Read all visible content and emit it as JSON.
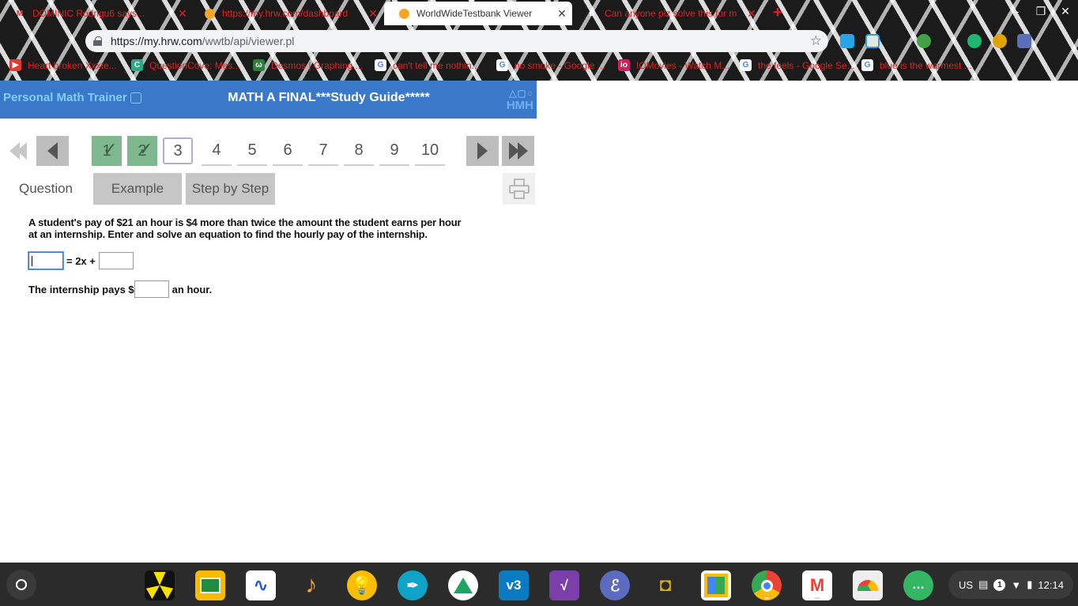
{
  "browser": {
    "tabs": [
      {
        "title": "DOMINIC Rodrigu6 says...",
        "icon": "gmail-icon",
        "active": false
      },
      {
        "title": "https://my.hrw.com/dashboard",
        "icon": "hrw-icon",
        "active": false
      },
      {
        "title": "WorldWideTestbank Viewer",
        "icon": "hrw-icon",
        "active": true
      },
      {
        "title": "Can anyone plz solve this for m",
        "icon": "brainly-icon",
        "active": false
      }
    ],
    "new_tab": "+",
    "url_host": "https://my.hrw.com",
    "url_path": "/wwtb/api/viewer.pl",
    "bookmarks": [
      {
        "label": "Heart broken Xxxte...",
        "icon": "youtube-icon",
        "color": "#e53935"
      },
      {
        "label": "QuestionCove: Mes...",
        "icon": "questioncove-icon",
        "color": "#2fa88a"
      },
      {
        "label": "Desmos | Graphing ...",
        "icon": "desmos-icon",
        "color": "#2a7f3a"
      },
      {
        "label": "can't tell me nothin...",
        "icon": "google-icon",
        "color": "#4285f4"
      },
      {
        "label": "no smoke - Google ...",
        "icon": "google-icon",
        "color": "#4285f4"
      },
      {
        "label": "IOMovies - Watch M...",
        "icon": "iomovies-icon",
        "color": "#d81b60"
      },
      {
        "label": "the feels - Google Se...",
        "icon": "google-icon",
        "color": "#4285f4"
      },
      {
        "label": "blue is the warmest ...",
        "icon": "google-icon",
        "color": "#4285f4"
      }
    ]
  },
  "app": {
    "brand": "Personal Math Trainer",
    "title": "MATH A FINAL***Study Guide*****",
    "logo_text": "HMH",
    "questions": [
      "1",
      "2",
      "3",
      "4",
      "5",
      "6",
      "7",
      "8",
      "9",
      "10"
    ],
    "current_question": "3",
    "tabs": {
      "question": "Question",
      "example": "Example",
      "step": "Step by Step"
    },
    "prompt": "A student's pay of $21 an hour is $4 more than twice the amount the student earns per hour at an internship. Enter and solve an equation to find the hourly pay of the internship.",
    "equation_middle": "= 2x +",
    "answer_prefix": "The internship pays $",
    "answer_suffix": "an hour.",
    "colors": {
      "header": "#3a78c9",
      "done": "#7fb88f"
    }
  },
  "shelf": {
    "apps": [
      "radiation-app-icon",
      "classroom-icon",
      "graph-app-icon",
      "music-icon",
      "keep-icon",
      "pen-app-icon",
      "drive-icon",
      "vernier-icon",
      "notebook-icon",
      "e-app-icon",
      "gold-app-icon",
      "board-icon",
      "chrome-icon",
      "gmail-icon",
      "cloud-print-icon",
      "chat-icon"
    ],
    "tray_lang": "US",
    "notification_count": "1",
    "time": "12:14"
  }
}
